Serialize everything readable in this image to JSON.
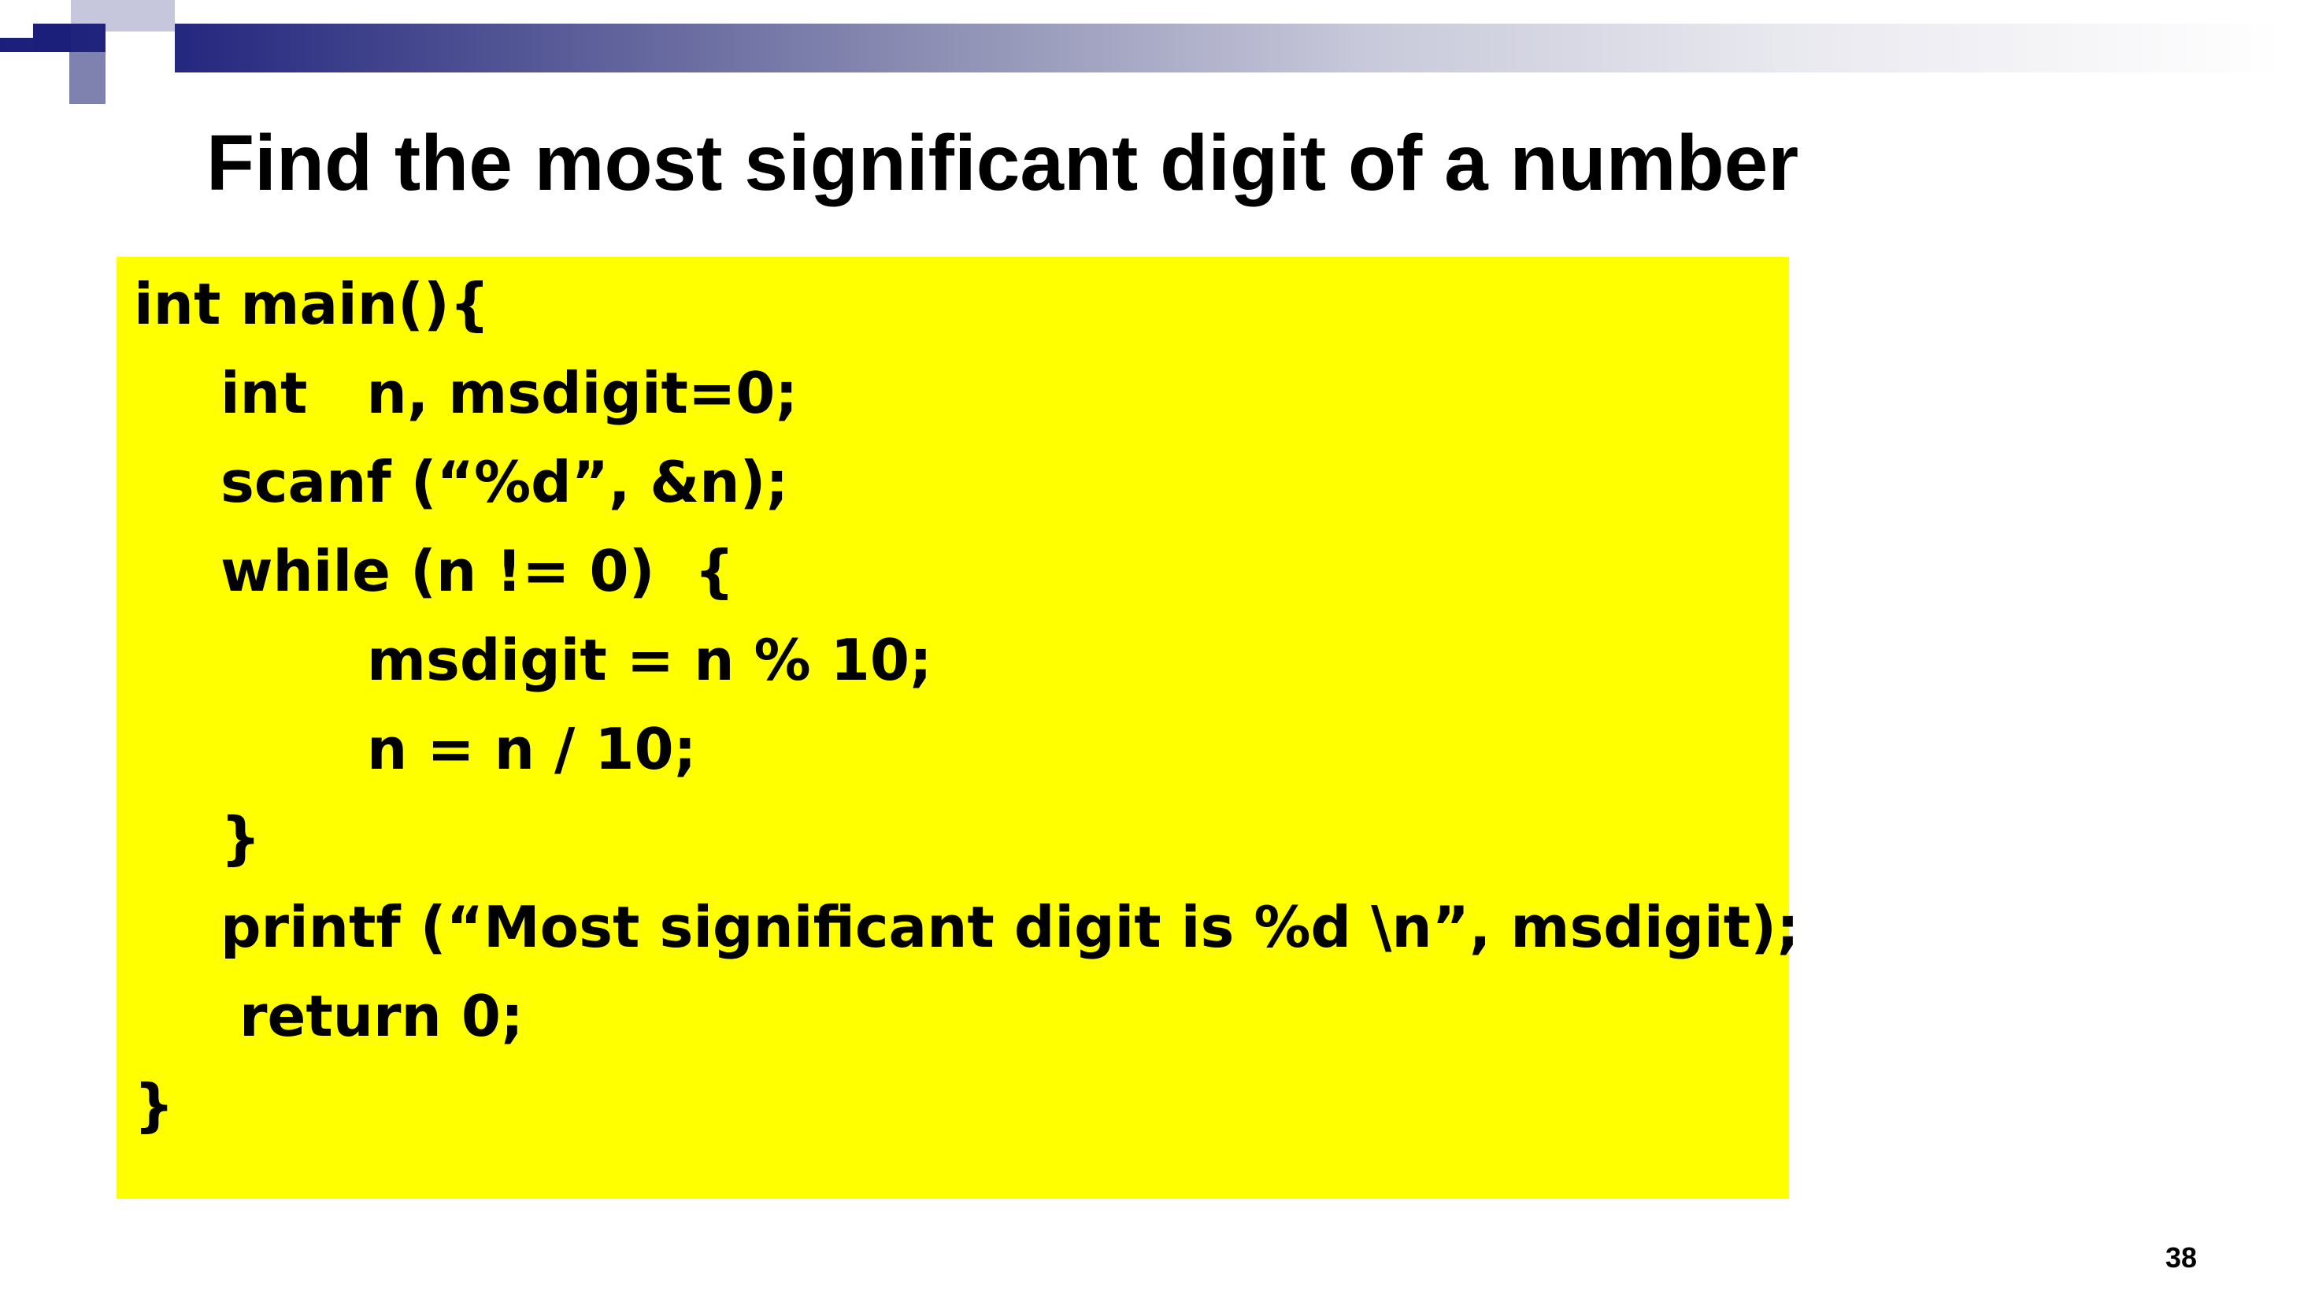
{
  "slide": {
    "title": "Find the most significant digit of a number",
    "page_number": "38"
  },
  "code": {
    "lines": [
      "int main(){",
      "int   n, msdigit=0;",
      "scanf (“%d”, &n);",
      "while (n != 0)  {",
      "msdigit = n % 10;",
      "n = n / 10;",
      "}",
      "printf (“Most significant digit is %d \\n”, msdigit);",
      "return 0;",
      "}"
    ]
  },
  "colors": {
    "code_background": "#ffff00",
    "header_band": "#1c1f7a"
  }
}
